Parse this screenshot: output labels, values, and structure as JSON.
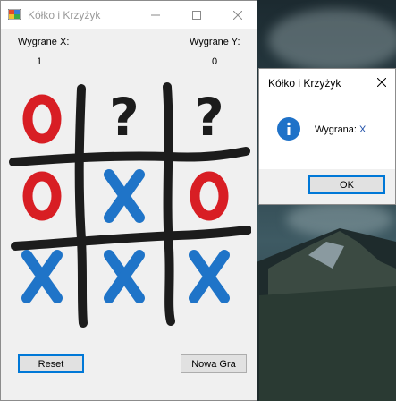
{
  "main_window": {
    "title": "Kółko i Krzyżyk",
    "score_x_label": "Wygrane X:",
    "score_x_value": "1",
    "score_y_label": "Wygrane Y:",
    "score_y_value": "0",
    "reset_label": "Reset",
    "new_game_label": "Nowa Gra",
    "board": [
      [
        "O",
        "?",
        "?"
      ],
      [
        "O",
        "X",
        "O"
      ],
      [
        "X",
        "X",
        "X"
      ]
    ]
  },
  "dialog": {
    "title": "Kółko i Krzyżyk",
    "message_prefix": "Wygrana: ",
    "message_winner": "X",
    "ok_label": "OK",
    "icon": "info-icon"
  },
  "colors": {
    "o_color": "#d81e24",
    "x_color": "#1f74c8",
    "mark_color": "#1c1c1c",
    "focus_border": "#0078d7"
  }
}
